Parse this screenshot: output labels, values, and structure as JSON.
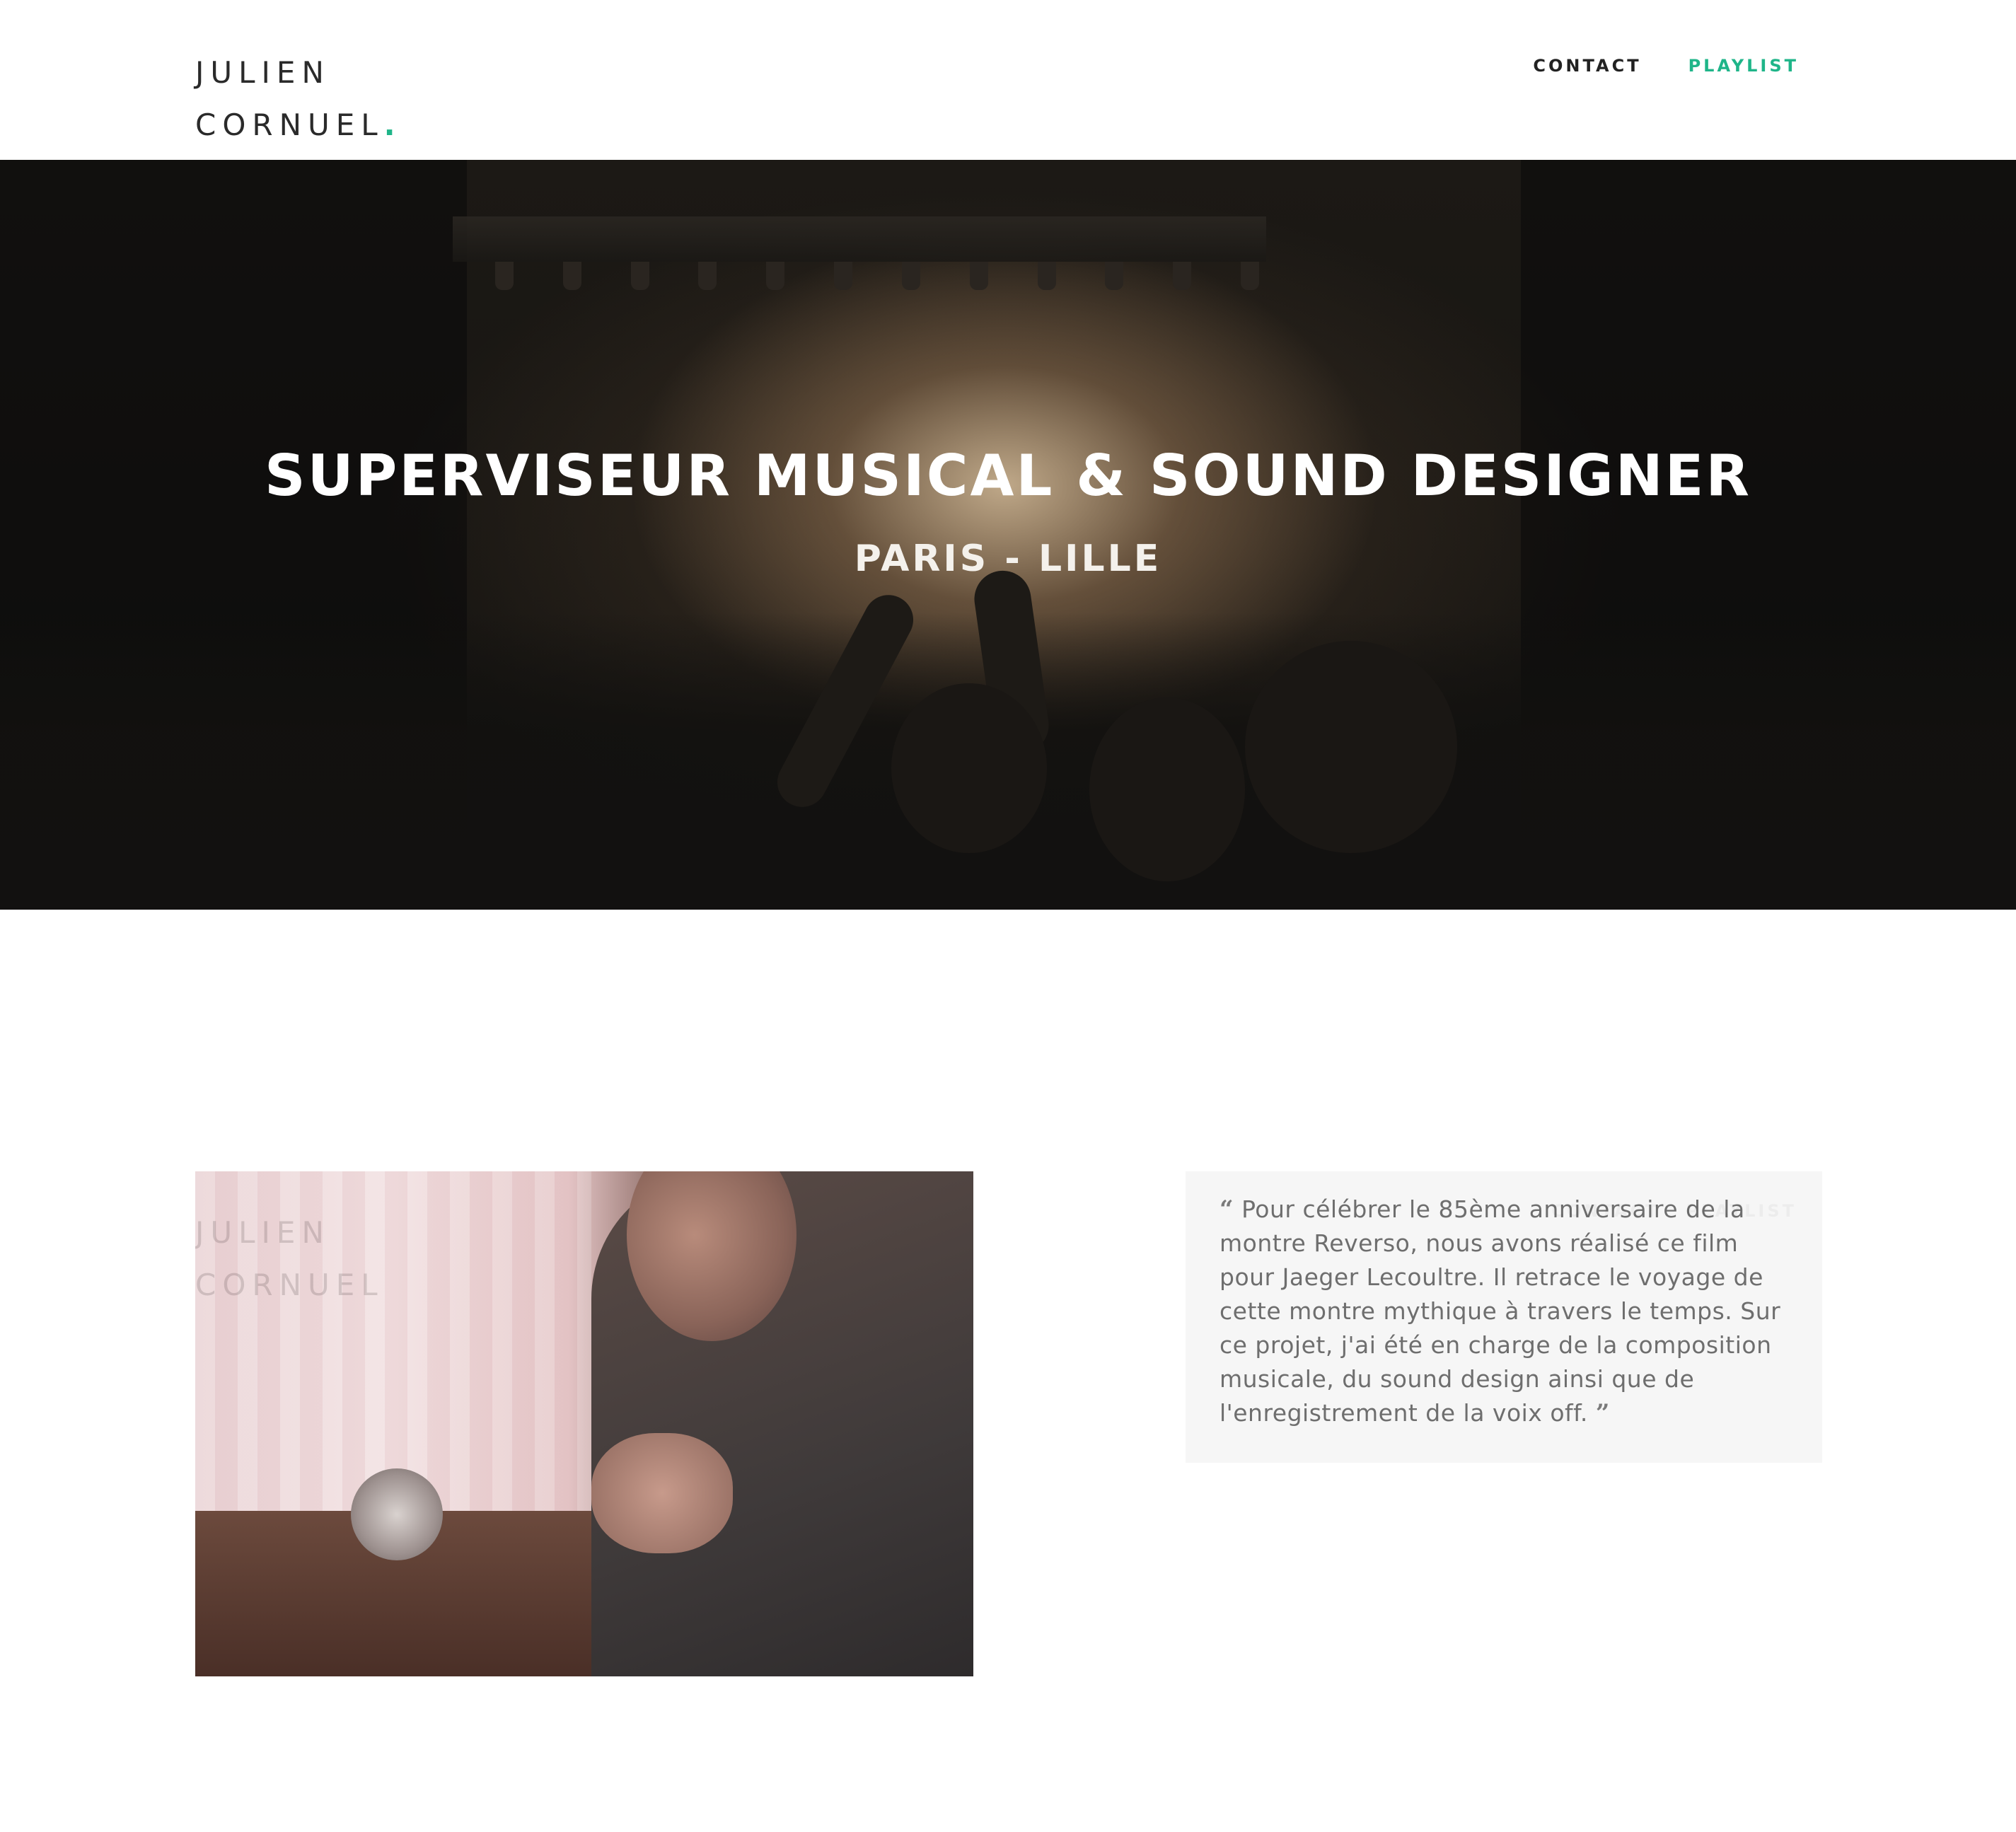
{
  "header": {
    "logo_line1": "JULIEN",
    "logo_line2": "CORNUEL",
    "logo_dot": ".",
    "nav": {
      "contact": "CONTACT",
      "playlist": "PLAYLIST"
    }
  },
  "hero": {
    "title": "SUPERVISEUR MUSICAL & SOUND DESIGNER",
    "subtitle": "PARIS - LILLE"
  },
  "project": {
    "quote_open": "“",
    "quote_close": "”",
    "quote": "Pour célébrer le 85ème anniversaire de la montre Reverso, nous avons réalisé ce film pour Jaeger Lecoultre. Il retrace le voyage de cette montre mythique à travers le temps. Sur ce projet, j'ai été en charge de la composition musicale, du sound design ainsi que de l'enregistrement de la voix off."
  },
  "colors": {
    "accent": "#1fb589",
    "text_dark": "#222222",
    "quote_bg": "#f6f6f6",
    "quote_text": "#6e6e6e"
  }
}
